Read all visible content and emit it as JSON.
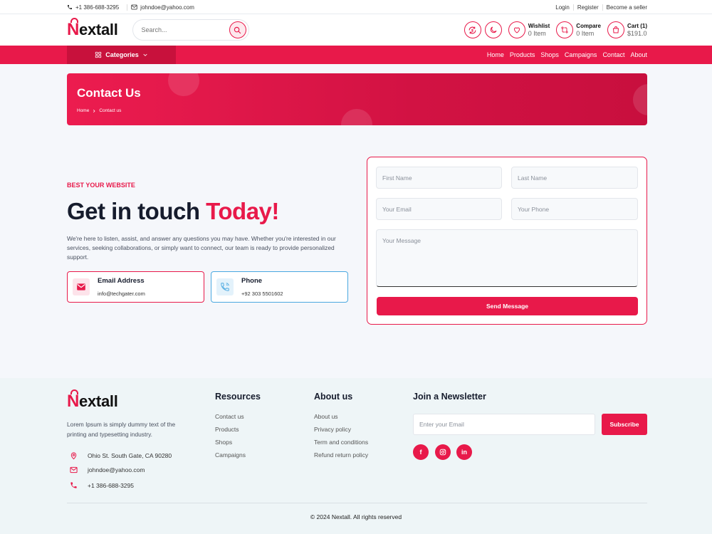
{
  "topbar": {
    "phone": "+1 386-688-3295",
    "email": "johndoe@yahoo.com",
    "login": "Login",
    "register": "Register",
    "seller": "Become a seller"
  },
  "header": {
    "logo_first": "N",
    "logo_rest": "extall",
    "search_placeholder": "Search...",
    "wishlist_label": "Wishlist",
    "wishlist_count": "0 Item",
    "compare_label": "Compare",
    "compare_count": "0 Item",
    "cart_label": "Cart (1)",
    "cart_total": "$191.0"
  },
  "nav": {
    "categories": "Categories",
    "menu": [
      "Home",
      "Products",
      "Shops",
      "Campaigns",
      "Contact",
      "About"
    ]
  },
  "banner": {
    "title": "Contact Us",
    "crumb_home": "Home",
    "crumb_current": "Contact us"
  },
  "contact": {
    "tag": "BEST YOUR WEBSITE",
    "headline_main": "Get in touch ",
    "headline_accent": "Today!",
    "description": "We're here to listen, assist, and answer any questions you may have. Whether you're interested in our services, seeking collaborations, or simply want to connect, our team is ready to provide personalized support.",
    "email_title": "Email Address",
    "email_value": "info@techgater.com",
    "phone_title": "Phone",
    "phone_value": "+92 303 5501602"
  },
  "form": {
    "first_name": "First Name",
    "last_name": "Last Name",
    "email": "Your Email",
    "phone": "Your Phone",
    "message": "Your Message",
    "submit": "Send Message"
  },
  "footer": {
    "logo_first": "N",
    "logo_rest": "extall",
    "description": "Lorem Ipsum is simply dummy text of the printing and typesetting industry.",
    "address": "Ohio St. South Gate, CA 90280",
    "email": "johndoe@yahoo.com",
    "phone": "+1 386-688-3295",
    "resources_title": "Resources",
    "resources": [
      "Contact us",
      "Products",
      "Shops",
      "Campaigns"
    ],
    "about_title": "About us",
    "about": [
      "About us",
      "Privacy policy",
      "Term and conditions",
      "Refund return policy"
    ],
    "newsletter_title": "Join a Newsletter",
    "newsletter_placeholder": "Enter your Email",
    "subscribe": "Subscribe",
    "social": [
      "f",
      "ig",
      "in"
    ],
    "copyright": "© 2024 Nextall. All rights reserved"
  },
  "colors": {
    "accent": "#e8194a",
    "accent_dark": "#c8113c",
    "phone_card": "#4aa8e0"
  }
}
